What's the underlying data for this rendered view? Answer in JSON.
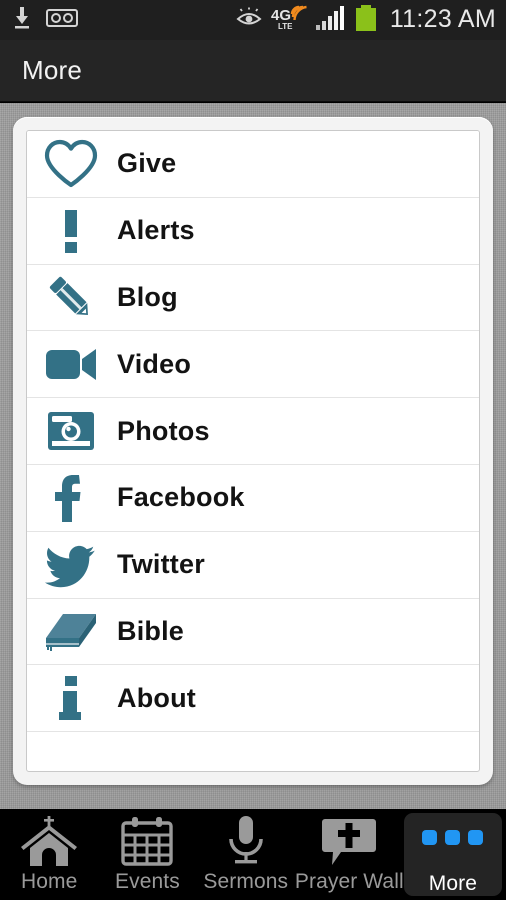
{
  "statusbar": {
    "time": "11:23 AM",
    "network_label": "4G",
    "network_sublabel": "LTE",
    "left_icons": [
      "download-icon",
      "voicemail-icon"
    ],
    "right_icons": [
      "eye-icon",
      "4g-lte-icon",
      "signal-bars-icon",
      "battery-icon"
    ],
    "battery_color": "#8bc11a",
    "network_arc_color": "#f08a1e",
    "bg_color": "#1f1f1f"
  },
  "header": {
    "title": "More",
    "bg_color": "#252525"
  },
  "menu": {
    "accent_color": "#337186",
    "items": [
      {
        "label": "Give",
        "icon": "heart-icon"
      },
      {
        "label": "Alerts",
        "icon": "exclamation-icon"
      },
      {
        "label": "Blog",
        "icon": "pencil-icon"
      },
      {
        "label": "Video",
        "icon": "video-camera-icon"
      },
      {
        "label": "Photos",
        "icon": "camera-icon"
      },
      {
        "label": "Facebook",
        "icon": "facebook-icon"
      },
      {
        "label": "Twitter",
        "icon": "twitter-bird-icon"
      },
      {
        "label": "Bible",
        "icon": "book-icon"
      },
      {
        "label": "About",
        "icon": "info-icon"
      }
    ]
  },
  "tabbar": {
    "selected_color": "#2196f3",
    "inactive_color": "#9a9a9a",
    "tabs": [
      {
        "label": "Home",
        "icon": "church-icon",
        "selected": false
      },
      {
        "label": "Events",
        "icon": "calendar-icon",
        "selected": false
      },
      {
        "label": "Sermons",
        "icon": "microphone-icon",
        "selected": false
      },
      {
        "label": "Prayer Wall",
        "icon": "speech-cross-icon",
        "selected": false
      },
      {
        "label": "More",
        "icon": "three-dots-icon",
        "selected": true
      }
    ]
  }
}
